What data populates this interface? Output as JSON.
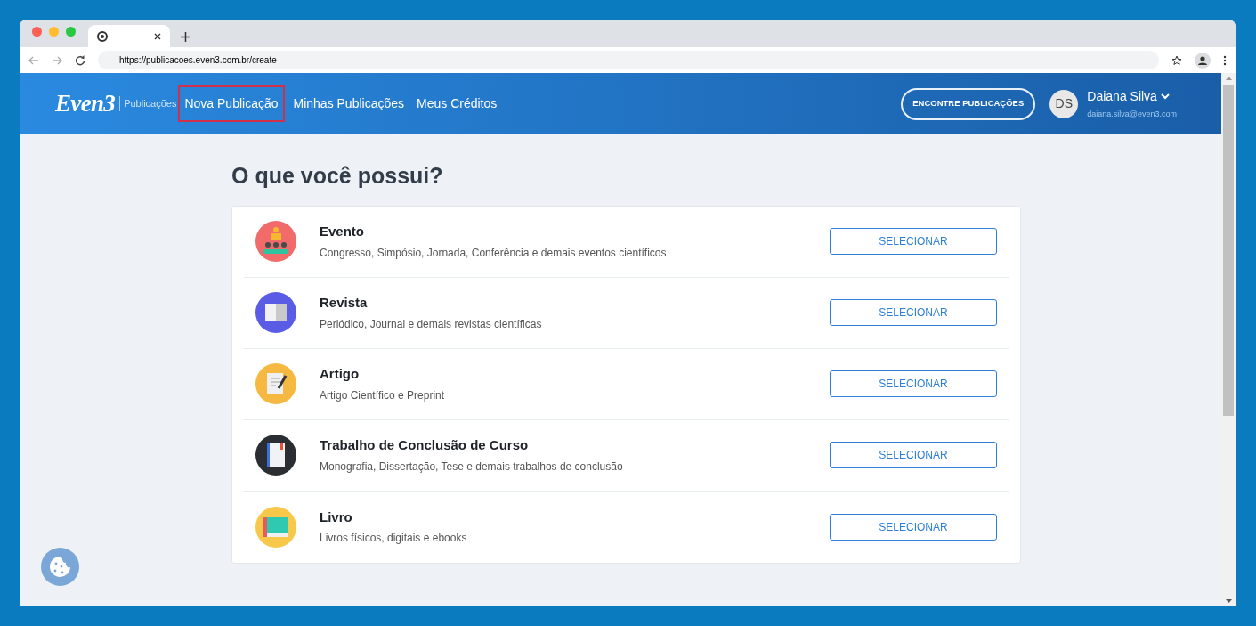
{
  "browser": {
    "url": "https://publicacoes.even3.com.br/create"
  },
  "header": {
    "logo": "Even3",
    "product": "Publicações",
    "nav": [
      {
        "label": "Nova Publicação",
        "selected": true
      },
      {
        "label": "Minhas Publicações",
        "selected": false
      },
      {
        "label": "Meus Créditos",
        "selected": false
      }
    ],
    "find_button": "ENCONTRE PUBLICAÇÕES",
    "user": {
      "initials": "DS",
      "name": "Daiana Silva",
      "email": "daiana.silva@even3.com"
    }
  },
  "page": {
    "title": "O que você possui?",
    "options": [
      {
        "kind": "event",
        "title": "Evento",
        "description": "Congresso, Simpósio, Jornada, Conferência e demais eventos científicos",
        "button": "SELECIONAR"
      },
      {
        "kind": "magazine",
        "title": "Revista",
        "description": "Periódico, Journal e demais revistas científicas",
        "button": "SELECIONAR"
      },
      {
        "kind": "article",
        "title": "Artigo",
        "description": "Artigo Científico e Preprint",
        "button": "SELECIONAR"
      },
      {
        "kind": "thesis",
        "title": "Trabalho de Conclusão de Curso",
        "description": "Monografia, Dissertação, Tese e demais trabalhos de conclusão",
        "button": "SELECIONAR"
      },
      {
        "kind": "book",
        "title": "Livro",
        "description": "Livros físicos, digitais e ebooks",
        "button": "SELECIONAR"
      }
    ]
  }
}
